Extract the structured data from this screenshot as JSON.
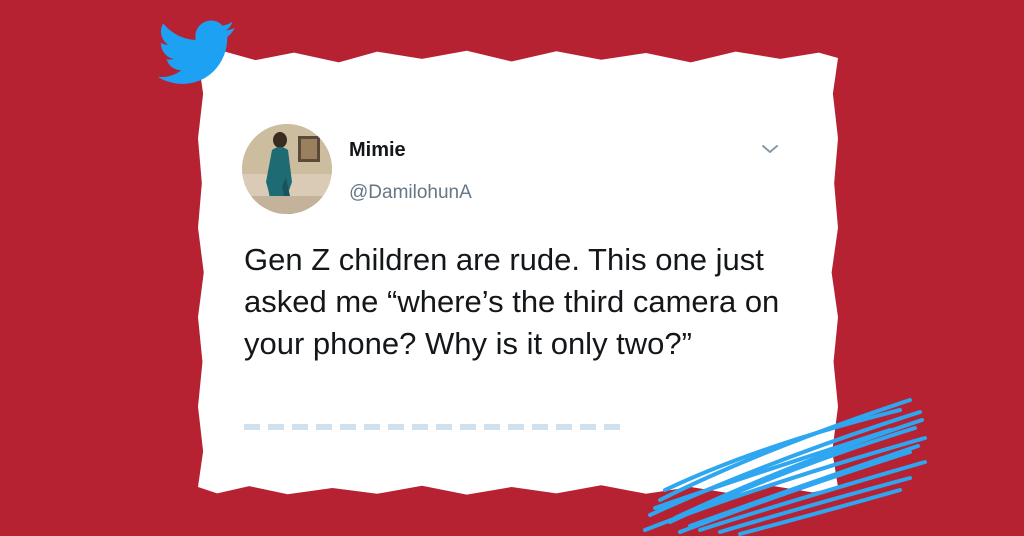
{
  "tweet": {
    "display_name": "Mimie",
    "handle": "@DamilohunA",
    "text": "Gen Z children are rude. This one just asked me “where’s the third camera on your phone? Why is it only two?”"
  },
  "icons": {
    "brand": "twitter-bird-icon",
    "menu": "chevron-down-icon"
  },
  "colors": {
    "background": "#b72233",
    "card": "#ffffff",
    "twitter_blue": "#1da1f2",
    "text": "#14171a",
    "secondary_text": "#657786",
    "scribble": "#2fa6f0"
  }
}
